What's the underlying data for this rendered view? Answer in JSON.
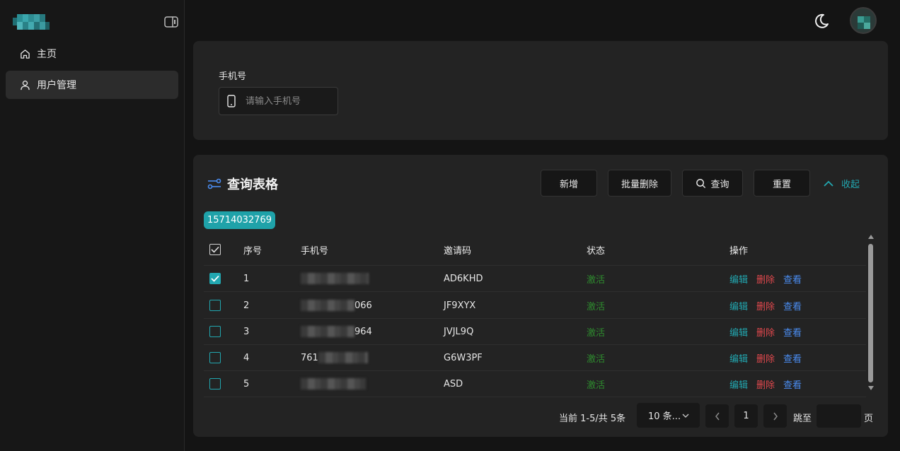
{
  "sidebar": {
    "items": [
      {
        "label": "主页"
      },
      {
        "label": "用户管理"
      }
    ]
  },
  "search": {
    "phone_label": "手机号",
    "phone_placeholder": "请输入手机号"
  },
  "table_card": {
    "title": "查询表格",
    "buttons": {
      "add": "新增",
      "batch_delete": "批量删除",
      "query": "查询",
      "reset": "重置",
      "collapse": "收起"
    },
    "filter_tag": "15714032769",
    "columns": [
      "序号",
      "手机号",
      "邀请码",
      "状态",
      "操作"
    ],
    "rows": [
      {
        "index": "1",
        "invite_code": "AD6KHD",
        "status": "激活",
        "checked": true
      },
      {
        "index": "2",
        "phone_suffix": "066",
        "invite_code": "JF9XYX",
        "status": "激活",
        "checked": false
      },
      {
        "index": "3",
        "phone_suffix": "964",
        "invite_code": "JVJL9Q",
        "status": "激活",
        "checked": false
      },
      {
        "index": "4",
        "phone_prefix": "761",
        "invite_code": "G6W3PF",
        "status": "激活",
        "checked": false
      },
      {
        "index": "5",
        "invite_code": "ASD",
        "status": "激活",
        "checked": false
      }
    ],
    "actions": {
      "edit": "编辑",
      "delete": "删除",
      "view": "查看"
    }
  },
  "pagination": {
    "total_text": "当前 1-5/共 5条",
    "page_size": "10 条...",
    "current_page": "1",
    "jump_label": "跳至",
    "page_label": "页"
  },
  "colors": {
    "accent": "#22a7b0",
    "danger": "#e0484d",
    "link": "#4a8cf0",
    "success": "#2e8b2e"
  }
}
